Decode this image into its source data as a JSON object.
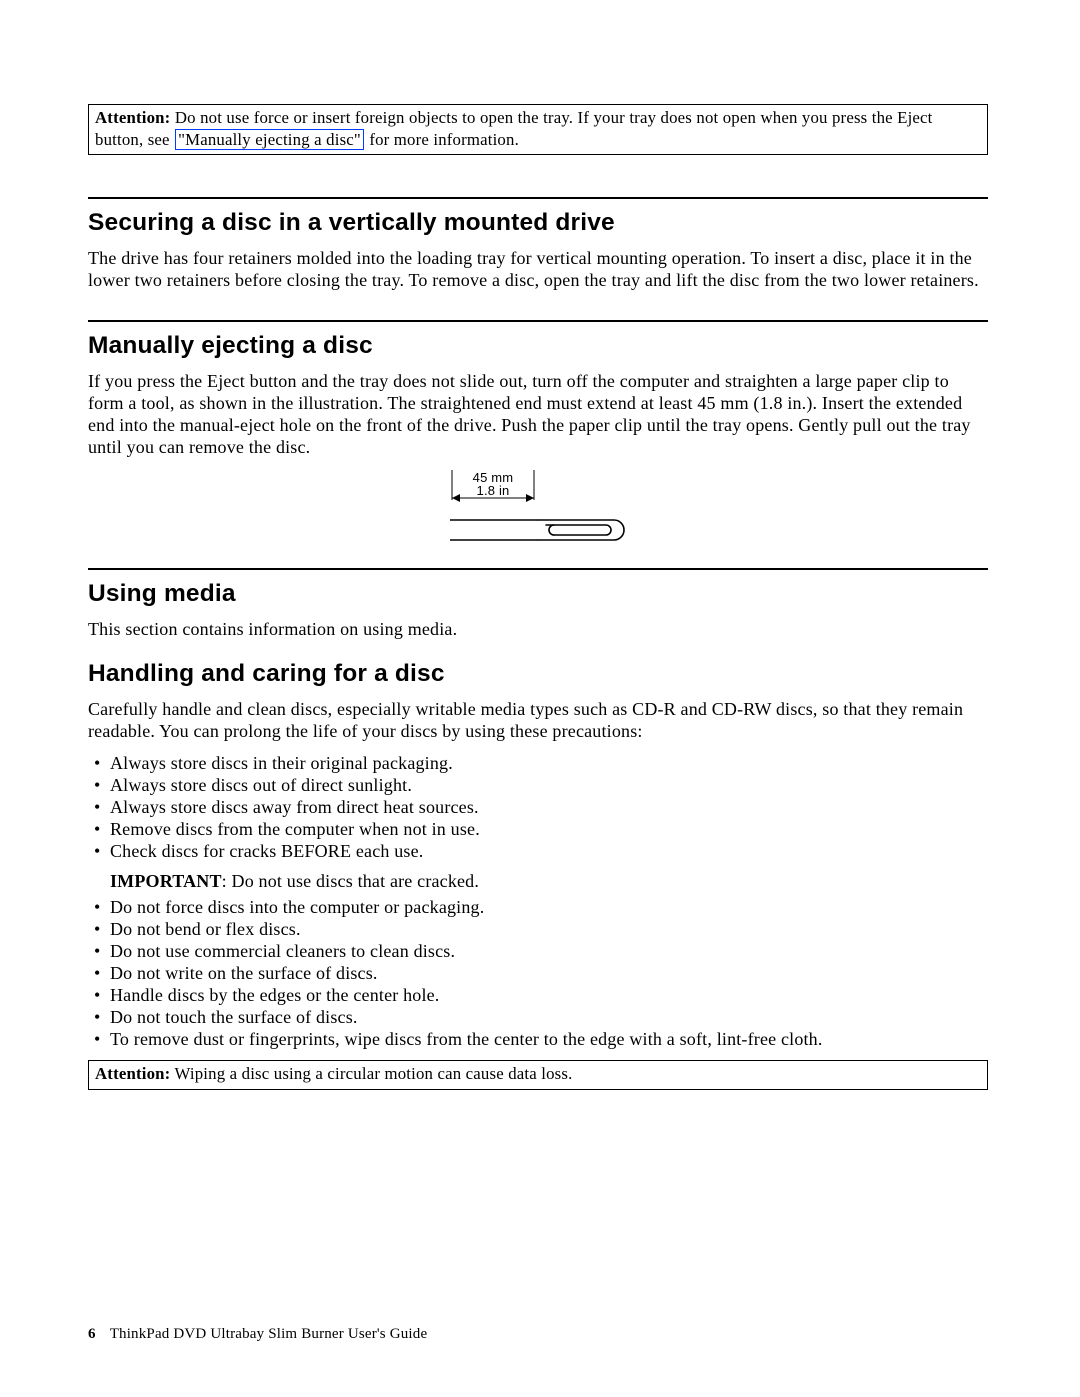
{
  "attention1": {
    "lead": "Attention:",
    "before_ref": " Do not use force or insert foreign objects to open the tray. If your tray does not open when you press the Eject button, see ",
    "ref": "\"Manually ejecting a disc\"",
    "after_ref": " for more information."
  },
  "sec1": {
    "title": "Securing a disc in a vertically mounted drive",
    "body": "The drive has four retainers molded into the loading tray for vertical mounting operation. To insert a disc, place it in the lower two retainers before closing the tray. To remove a disc, open the tray and lift the disc from the two lower retainers."
  },
  "sec2": {
    "title": "Manually ejecting a disc",
    "body": "If you press the Eject button and the tray does not slide out, turn off the computer and straighten a large paper clip to form a tool, as shown in the illustration. The straightened end must extend at least 45 mm (1.8 in.). Insert the extended end into the manual-eject hole on the front of the drive. Push the paper clip until the tray opens. Gently pull out the tray until you can remove the disc."
  },
  "illus": {
    "dim_mm": "45 mm",
    "dim_in": "1.8 in"
  },
  "sec3": {
    "title": "Using media",
    "body": "This section contains information on using media."
  },
  "sec4": {
    "title": "Handling and caring for a disc",
    "body": "Carefully handle and clean discs, especially writable media types such as CD-R and CD-RW discs, so that they remain readable. You can prolong the life of your discs by using these precautions:"
  },
  "listA": {
    "i0": "Always store discs in their original packaging.",
    "i1": "Always store discs out of direct sunlight.",
    "i2": "Always store discs away from direct heat sources.",
    "i3": "Remove discs from the computer when not in use.",
    "i4": "Check discs for cracks BEFORE each use."
  },
  "important": {
    "lead": "IMPORTANT",
    "rest": ": Do not use discs that are cracked."
  },
  "listB": {
    "i0": "Do not force discs into the computer or packaging.",
    "i1": "Do not bend or flex discs.",
    "i2": "Do not use commercial cleaners to clean discs.",
    "i3": "Do not write on the surface of discs.",
    "i4": "Handle discs by the edges or the center hole.",
    "i5": "Do not touch the surface of discs.",
    "i6": "To remove dust or fingerprints, wipe discs from the center to the edge with a soft, lint-free cloth."
  },
  "attention2": {
    "lead": "Attention:",
    "rest": " Wiping a disc using a circular motion can cause data loss."
  },
  "footer": {
    "page": "6",
    "title": "ThinkPad DVD Ultrabay Slim Burner User's Guide"
  }
}
